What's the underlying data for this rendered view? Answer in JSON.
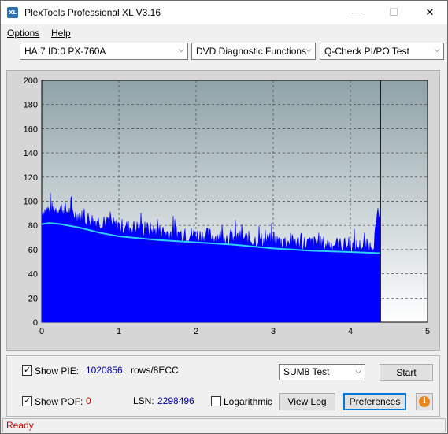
{
  "window": {
    "title": "PlexTools Professional XL V3.16",
    "icon_text": "XL",
    "minimize_glyph": "—",
    "maximize_glyph": "☐",
    "close_glyph": "✕"
  },
  "menu": {
    "options_label": "Options",
    "help_label": "Help"
  },
  "toolbar": {
    "drive": "HA:7 ID:0  PX-760A",
    "function": "DVD Diagnostic Functions",
    "test": "Q-Check PI/PO Test",
    "arrow_glyph": "⌵"
  },
  "controls": {
    "show_pie_label": "Show PIE:",
    "show_pie_checked": true,
    "pie_value": "1020856",
    "pie_unit": "rows/8ECC",
    "show_pof_label": "Show POF:",
    "show_pof_checked": true,
    "pof_value": "0",
    "lsn_label": "LSN:",
    "lsn_value": "2298496",
    "logarithmic_label": "Logarithmic",
    "logarithmic_checked": false,
    "sum_select": "SUM8 Test",
    "start_label": "Start",
    "view_log_label": "View Log",
    "preferences_label": "Preferences",
    "info_glyph": "i"
  },
  "status": {
    "text": "Ready"
  },
  "colors": {
    "plot_bg_top": "#8fa3a8",
    "plot_bg_bottom": "#ffffff",
    "bars": "#0000ff",
    "avg_line": "#30d0ff",
    "marker_line": "#000000"
  },
  "chart_data": {
    "type": "bar",
    "xlim": [
      0,
      5
    ],
    "ylim": [
      0,
      200
    ],
    "x_ticks": [
      "0",
      "1",
      "2",
      "3",
      "4",
      "5"
    ],
    "y_ticks": [
      "0",
      "20",
      "40",
      "60",
      "80",
      "100",
      "120",
      "140",
      "160",
      "180",
      "200"
    ],
    "grid": true,
    "end_marker_x": 4.39,
    "series": [
      {
        "x": [
          0.0,
          0.25,
          0.5,
          0.75,
          1.0,
          1.25,
          1.5,
          1.75,
          2.0,
          2.25,
          2.5,
          2.75,
          3.0,
          3.25,
          3.5,
          3.75,
          4.0,
          4.25,
          4.3,
          4.35,
          4.39
        ],
        "values": [
          93,
          95,
          88,
          84,
          80,
          79,
          76,
          74,
          73,
          72,
          71,
          69,
          68,
          67,
          66,
          65,
          64,
          63,
          66,
          85,
          92
        ]
      },
      {
        "x": [
          0.0,
          0.1,
          0.25,
          0.5,
          0.75,
          1.0,
          1.5,
          2.0,
          2.5,
          3.0,
          3.5,
          4.0,
          4.39
        ],
        "values": [
          81,
          82,
          81,
          78,
          74,
          71,
          68,
          66,
          64,
          61,
          59,
          58,
          57
        ]
      }
    ]
  }
}
